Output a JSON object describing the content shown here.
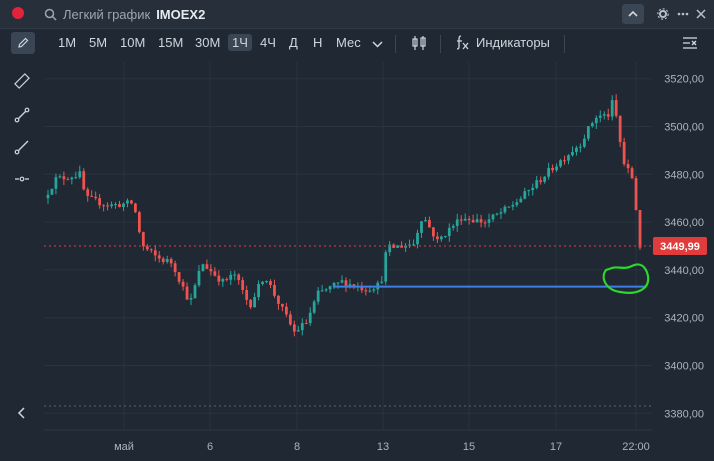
{
  "title_bar": {
    "search_label": "Легкий график",
    "ticker": "IMOEX2"
  },
  "toolbar": {
    "timeframes": [
      "1М",
      "5М",
      "10М",
      "15М",
      "30М",
      "1Ч",
      "4Ч",
      "Д",
      "Н",
      "Мес"
    ],
    "active_timeframe": "1Ч",
    "indicators_label": "Индикаторы"
  },
  "colors": {
    "up": "#26a69a",
    "down": "#ef5350",
    "price_badge": "#e13b3b",
    "hline": "#3d7ee8",
    "marker": "#2bd82b",
    "background": "#1f2833"
  },
  "chart_data": {
    "type": "candlestick",
    "title": "",
    "ylim": [
      3373,
      3527
    ],
    "y_ticks": [
      3380,
      3400,
      3420,
      3440,
      3460,
      3480,
      3500,
      3520
    ],
    "y_tick_labels": [
      "3380,00",
      "3400,00",
      "3420,00",
      "3440,00",
      "3460,00",
      "3480,00",
      "3500,00",
      "3520,00"
    ],
    "x_tick_labels": [
      "май",
      "6",
      "8",
      "13",
      "15",
      "17",
      "22:00"
    ],
    "last_price": 3449.99,
    "last_price_label": "3449,99",
    "horizontal_line": 3433,
    "segments": [
      [
        0.0,
        3470
      ],
      [
        0.02,
        3478
      ],
      [
        0.06,
        3480
      ],
      [
        0.07,
        3470
      ],
      [
        0.11,
        3467
      ],
      [
        0.15,
        3468
      ],
      [
        0.165,
        3450
      ],
      [
        0.19,
        3445
      ],
      [
        0.215,
        3443
      ],
      [
        0.245,
        3426
      ],
      [
        0.265,
        3443
      ],
      [
        0.3,
        3435
      ],
      [
        0.32,
        3438
      ],
      [
        0.345,
        3425
      ],
      [
        0.37,
        3438
      ],
      [
        0.39,
        3428
      ],
      [
        0.42,
        3414
      ],
      [
        0.44,
        3418
      ],
      [
        0.46,
        3430
      ],
      [
        0.5,
        3435
      ],
      [
        0.54,
        3432
      ],
      [
        0.565,
        3434
      ],
      [
        0.575,
        3449
      ],
      [
        0.62,
        3451
      ],
      [
        0.635,
        3463
      ],
      [
        0.66,
        3452
      ],
      [
        0.7,
        3462
      ],
      [
        0.74,
        3460
      ],
      [
        0.78,
        3466
      ],
      [
        0.8,
        3470
      ],
      [
        0.85,
        3482
      ],
      [
        0.9,
        3493
      ],
      [
        0.925,
        3504
      ],
      [
        0.95,
        3505
      ],
      [
        0.955,
        3512
      ],
      [
        0.972,
        3485
      ],
      [
        0.988,
        3478
      ],
      [
        1.0,
        3450
      ]
    ]
  }
}
